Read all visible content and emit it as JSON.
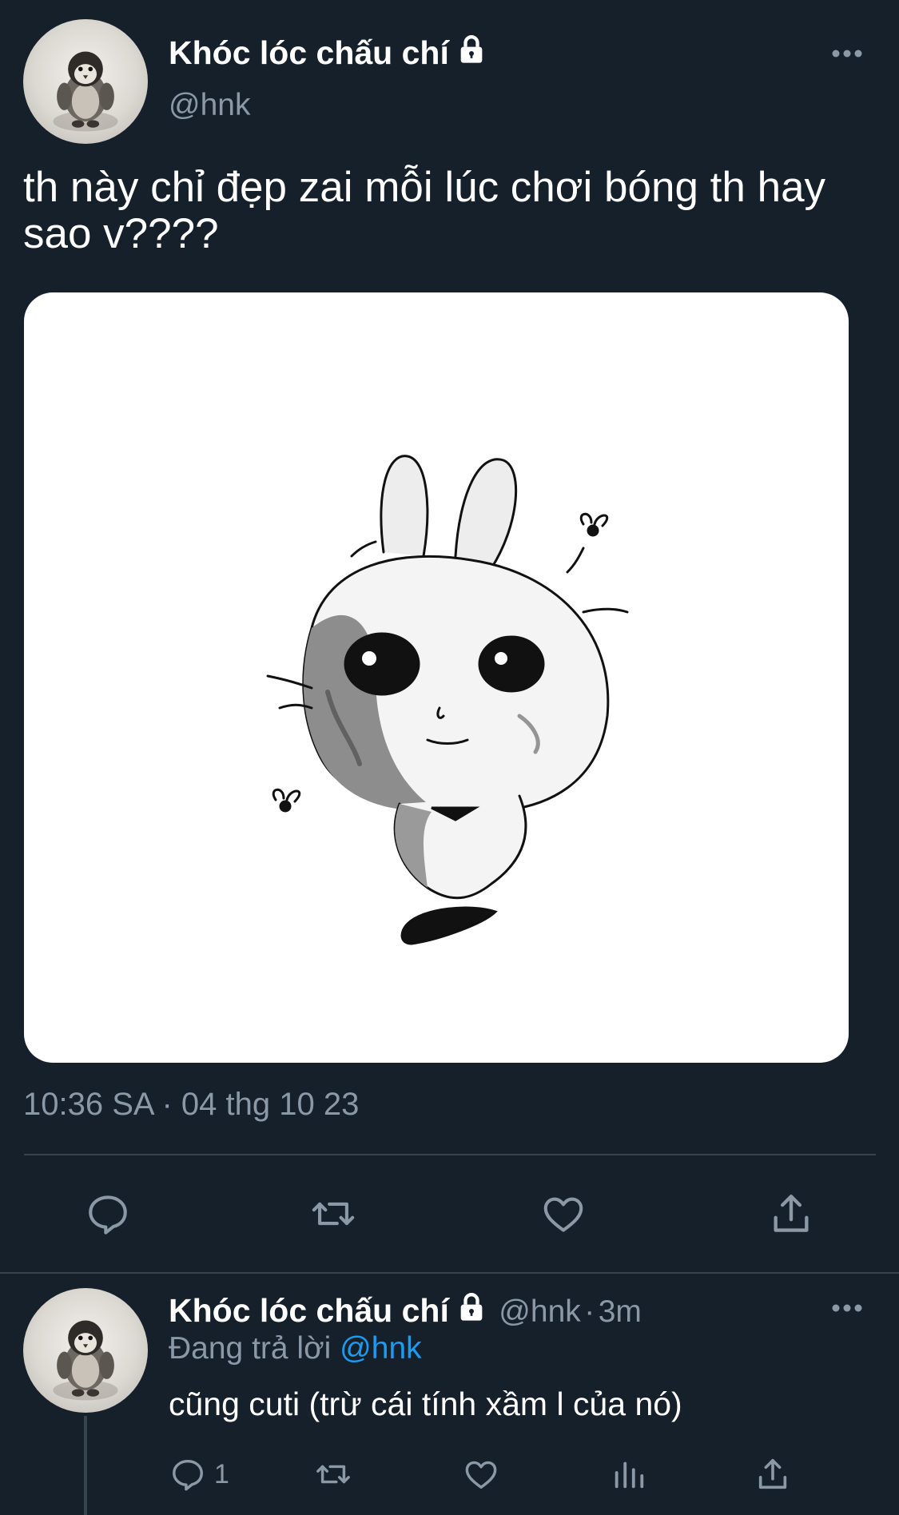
{
  "tweet": {
    "display_name": "Khóc lóc chấu chí",
    "handle": "@hnk",
    "text": "th này chỉ đẹp zai mỗi lúc chơi bóng th hay sao v????",
    "timestamp": "10:36 SA · 04 thg 10 23",
    "more_icon": "more-dots-icon",
    "locked_icon": "lock-icon"
  },
  "actions": {
    "reply_icon": "reply-icon",
    "retweet_icon": "retweet-icon",
    "like_icon": "heart-icon",
    "share_icon": "share-icon"
  },
  "reply": {
    "display_name": "Khóc lóc chấu chí",
    "handle": "@hnk",
    "separator": "·",
    "time": "3m",
    "replying_prefix": "Đang trả lời",
    "replying_to": "@hnk",
    "text": "cũng cuti (trừ cái tính xầm l của nó)",
    "reply_count": "1"
  },
  "colors": {
    "background": "#15202b",
    "secondary_text": "#8b98a5",
    "accent": "#1d9bf0",
    "divider": "#38444d"
  }
}
